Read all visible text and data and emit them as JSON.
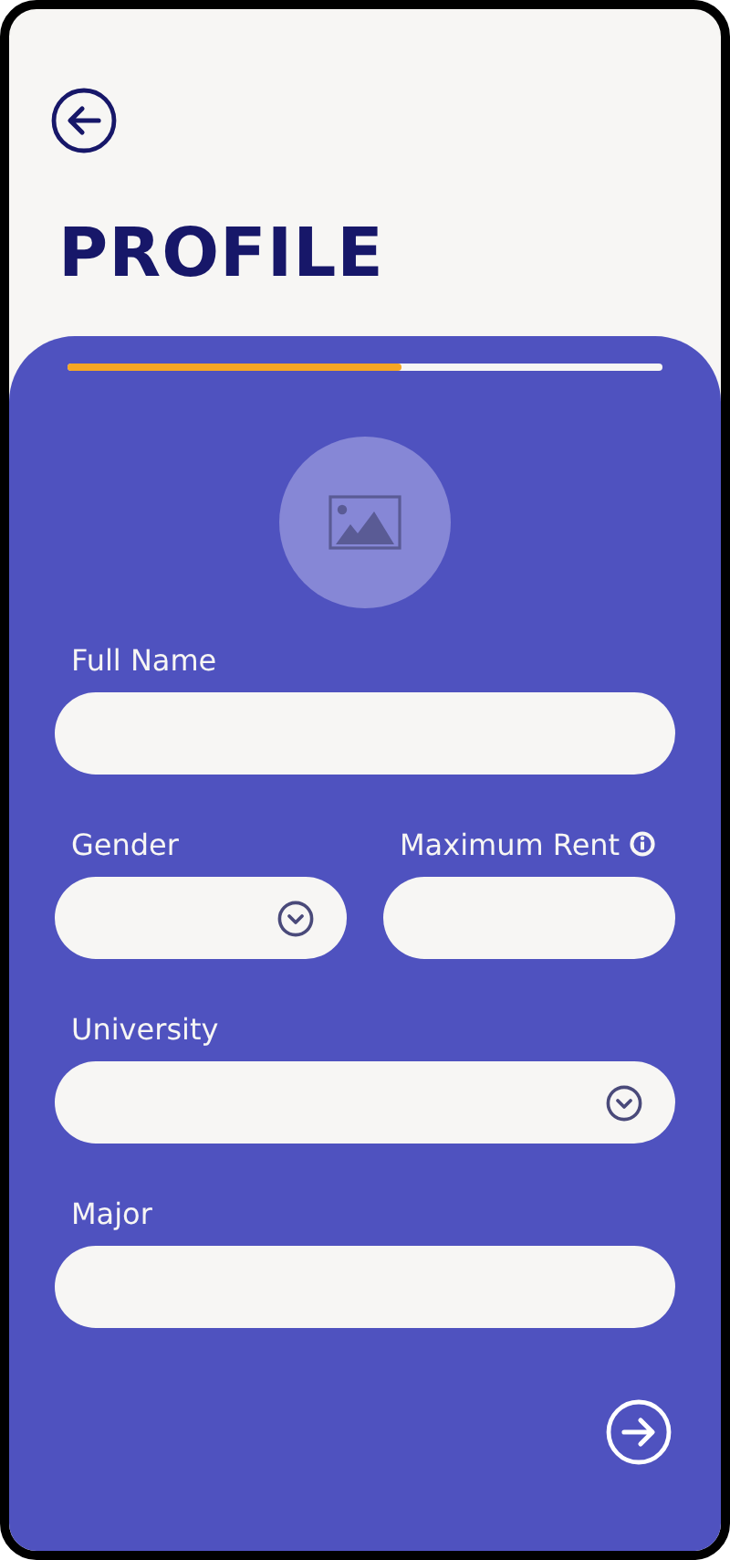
{
  "title": "PROFILE",
  "progress": {
    "level": 0.56
  },
  "rows": [
    [
      {
        "label": "Full Name",
        "kind": "text",
        "info": false
      }
    ],
    [
      {
        "label": "Gender",
        "kind": "select",
        "info": false
      },
      {
        "label": "Maximum Rent",
        "kind": "text",
        "info": true
      }
    ],
    [
      {
        "label": "University",
        "kind": "select",
        "info": false
      }
    ],
    [
      {
        "label": "Major",
        "kind": "text",
        "info": false
      }
    ]
  ]
}
